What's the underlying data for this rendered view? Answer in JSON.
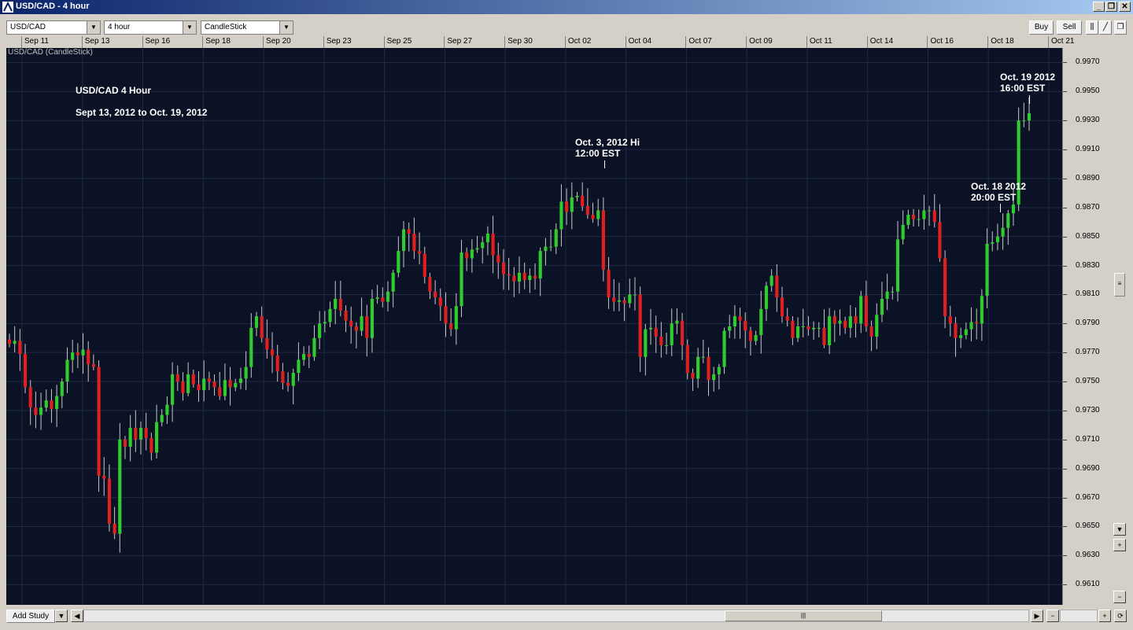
{
  "window": {
    "title": "USD/CAD - 4 hour"
  },
  "toolbar": {
    "symbol": "USD/CAD",
    "timeframe": "4 hour",
    "chart_style": "CandleStick",
    "buy_label": "Buy",
    "sell_label": "Sell"
  },
  "chart_caption": "USD/CAD (CandleStick)",
  "bottom": {
    "add_study_label": "Add Study"
  },
  "chart_data": {
    "type": "candlestick",
    "title": "USD/CAD 4 Hour",
    "subtitle": "Sept 13, 2012 to Oct. 19, 2012",
    "x_ticks": [
      "Sep 11",
      "Sep 13",
      "Sep 16",
      "Sep 18",
      "Sep 20",
      "Sep 23",
      "Sep 25",
      "Sep 27",
      "Sep 30",
      "Oct 02",
      "Oct 04",
      "Oct 07",
      "Oct 09",
      "Oct 11",
      "Oct 14",
      "Oct 16",
      "Oct 18",
      "Oct 21"
    ],
    "y_ticks": [
      "0.9970",
      "0.9950",
      "0.9930",
      "0.9910",
      "0.9890",
      "0.9870",
      "0.9850",
      "0.9830",
      "0.9810",
      "0.9790",
      "0.9770",
      "0.9750",
      "0.9730",
      "0.9710",
      "0.9690",
      "0.9670",
      "0.9650",
      "0.9630",
      "0.9610"
    ],
    "ylim": [
      0.9596,
      0.998
    ],
    "up_color": "#2ecc2e",
    "down_color": "#e02020",
    "annotations": [
      {
        "line1": "Oct. 3, 2012 Hi",
        "line2": "12:00 EST"
      },
      {
        "line1": "Oct. 18 2012",
        "line2": "20:00 EST"
      },
      {
        "line1": "Oct. 19 2012",
        "line2": "16:00 EST"
      }
    ],
    "closes": [
      0.9776,
      0.9778,
      0.9769,
      0.9746,
      0.9732,
      0.9727,
      0.9732,
      0.9737,
      0.9731,
      0.974,
      0.975,
      0.9765,
      0.977,
      0.9768,
      0.9772,
      0.9762,
      0.976,
      0.9685,
      0.9683,
      0.9652,
      0.9645,
      0.971,
      0.9705,
      0.9718,
      0.971,
      0.9718,
      0.9711,
      0.9701,
      0.9722,
      0.9727,
      0.9734,
      0.9755,
      0.975,
      0.9742,
      0.9755,
      0.9748,
      0.9744,
      0.9752,
      0.975,
      0.9746,
      0.974,
      0.9751,
      0.9746,
      0.9749,
      0.9752,
      0.976,
      0.9787,
      0.9795,
      0.978,
      0.9772,
      0.9768,
      0.9757,
      0.9749,
      0.9747,
      0.9756,
      0.9765,
      0.9769,
      0.9767,
      0.978,
      0.979,
      0.9791,
      0.98,
      0.9807,
      0.9799,
      0.9792,
      0.9788,
      0.9785,
      0.9795,
      0.978,
      0.9807,
      0.9808,
      0.9805,
      0.9812,
      0.9825,
      0.984,
      0.9855,
      0.9852,
      0.984,
      0.9838,
      0.9822,
      0.9812,
      0.9808,
      0.9802,
      0.979,
      0.9786,
      0.9802,
      0.9839,
      0.9835,
      0.9841,
      0.9842,
      0.9846,
      0.9852,
      0.9837,
      0.9832,
      0.9824,
      0.9823,
      0.9819,
      0.9825,
      0.982,
      0.9823,
      0.9821,
      0.984,
      0.9843,
      0.9843,
      0.9855,
      0.9874,
      0.9867,
      0.9877,
      0.9878,
      0.9871,
      0.9865,
      0.9862,
      0.9868,
      0.9827,
      0.9808,
      0.9805,
      0.9806,
      0.9804,
      0.981,
      0.981,
      0.9767,
      0.9786,
      0.9787,
      0.9781,
      0.9775,
      0.9775,
      0.979,
      0.9792,
      0.9775,
      0.9756,
      0.9752,
      0.9767,
      0.9767,
      0.9751,
      0.9755,
      0.976,
      0.9785,
      0.9788,
      0.9795,
      0.9792,
      0.9785,
      0.9778,
      0.9782,
      0.98,
      0.9816,
      0.9823,
      0.9808,
      0.9795,
      0.9792,
      0.978,
      0.9788,
      0.9788,
      0.9786,
      0.9787,
      0.9787,
      0.9775,
      0.9795,
      0.979,
      0.9792,
      0.9787,
      0.9795,
      0.979,
      0.9809,
      0.9788,
      0.9781,
      0.9796,
      0.9807,
      0.9812,
      0.9812,
      0.9848,
      0.9858,
      0.9865,
      0.9862,
      0.9862,
      0.9868,
      0.9868,
      0.986,
      0.9835,
      0.9795,
      0.979,
      0.978,
      0.9782,
      0.9786,
      0.9791,
      0.979,
      0.9809,
      0.9845,
      0.9846,
      0.985,
      0.9856,
      0.9866,
      0.9872,
      0.993,
      0.993,
      0.9935
    ]
  }
}
